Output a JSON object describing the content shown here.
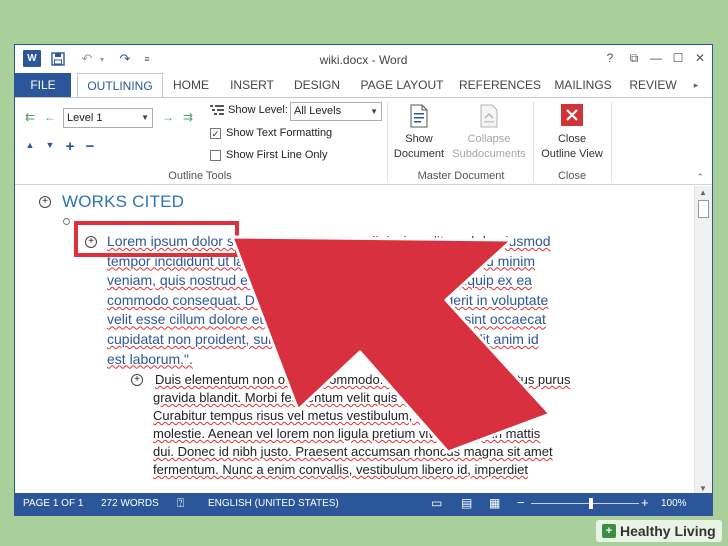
{
  "window": {
    "title": "wiki.docx - Word",
    "app_letter": "W"
  },
  "window_controls": {
    "help": "?",
    "restore": "⧉",
    "minimize": "—",
    "maximize": "☐",
    "close": "✕"
  },
  "quick_access": {
    "save_icon": "floppy-icon",
    "undo": "↶",
    "redo": "↷",
    "customize": "≡"
  },
  "tabs": [
    "FILE",
    "OUTLINING",
    "HOME",
    "INSERT",
    "DESIGN",
    "PAGE LAYOUT",
    "REFERENCES",
    "MAILINGS",
    "REVIEW"
  ],
  "active_tab": "OUTLINING",
  "ribbon": {
    "outline_tools": {
      "label": "Outline Tools",
      "level_value": "Level 1",
      "show_level_label": "Show Level:",
      "show_level_value": "All Levels",
      "show_text_formatting": "Show Text Formatting",
      "show_first_line_only": "Show First Line Only",
      "show_text_formatting_checked": true,
      "show_first_line_only_checked": false
    },
    "master_document": {
      "label": "Master Document",
      "show_document": [
        "Show",
        "Document"
      ],
      "collapse_subdocuments": [
        "Collapse",
        "Subdocuments"
      ]
    },
    "close_group": {
      "label": "Close",
      "close_outline_view": [
        "Close",
        "Outline View"
      ]
    }
  },
  "document": {
    "heading": "WORKS CITED",
    "paragraph1": [
      "Lorem ipsum dolor sit amet, consectetur adipiscing elit, sed do eiusmod",
      "tempor incididunt ut labore et dolore magna aliqua. Ut enim ad minim",
      "veniam, quis nostrud exercitation ullamco laboris nisi ut aliquip ex ea",
      "commodo consequat. Duis aute irure dolor in reprehenderit in voluptate",
      "velit esse cillum dolore eu fugiat nulla pariatur. Excepteur sint occaecat",
      "cupidatat non proident, sunt in culpa qui officia deserunt mollit anim id",
      "est laborum.\"."
    ],
    "paragraph2": [
      "Duis elementum non orci vel commodo. Cras in nisi at justo luctus purus",
      "gravida blandit. Morbi fermentum velit quis vitae accumsan.",
      "Curabitur tempus risus vel metus vestibulum, quis suscipit purus",
      "molestie. Aenean vel lorem non ligula pretium viverra. Sed in mattis",
      "dui. Donec id nibh justo. Praesent accumsan rhoncus magna sit amet",
      "fermentum. Nunc a enim convallis, vestibulum libero id, imperdiet"
    ]
  },
  "status_bar": {
    "page": "PAGE 1 OF 1",
    "words": "272 WORDS",
    "language": "ENGLISH (UNITED STATES)",
    "zoom": "100%",
    "minus": "−",
    "plus": "+"
  },
  "watermark": {
    "text": "Healthy Living"
  },
  "colors": {
    "word_blue": "#2b579a",
    "highlight_red": "#e0303b",
    "background_green": "#a9cf9a"
  }
}
